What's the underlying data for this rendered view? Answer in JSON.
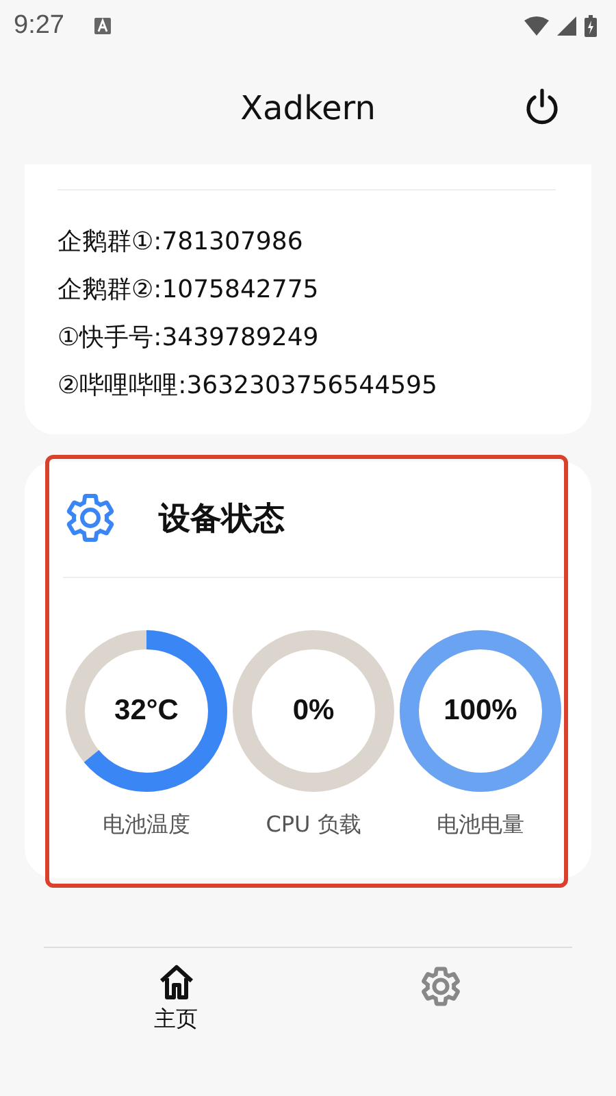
{
  "status_bar": {
    "time": "9:27"
  },
  "header": {
    "title": "Xadkern"
  },
  "info_card": {
    "lines": [
      "企鹅群①:781307986",
      "企鹅群②:1075842775",
      "①快手号:3439789249",
      "②哔哩哔哩:3632303756544595"
    ]
  },
  "device_status": {
    "title": "设备状态",
    "gauges": [
      {
        "value": "32°C",
        "label": "电池温度",
        "level": 0.64,
        "color": "#3a86f5"
      },
      {
        "value": "0%",
        "label": "CPU 负载",
        "level": 0
      },
      {
        "value": "100%",
        "label": "电池电量",
        "level": 1,
        "color": "#6aa3f2"
      }
    ]
  },
  "bottom_nav": [
    {
      "kind": "home",
      "label": "主页",
      "selected": true
    },
    {
      "kind": "settings",
      "selected": false
    }
  ]
}
